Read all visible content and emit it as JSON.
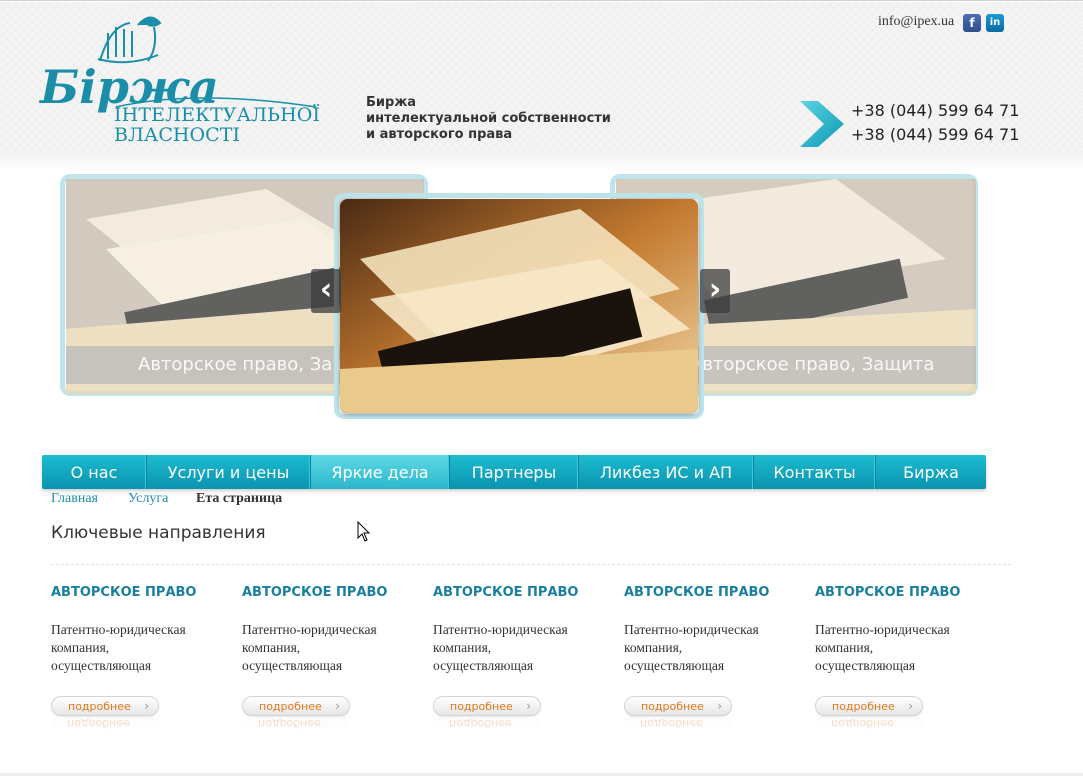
{
  "header": {
    "logo": {
      "script_text": "Біржа",
      "line1": "ІНТЕЛЕКТУАЛЬНОЇ",
      "line2": "ВЛАСНОСТІ"
    },
    "tagline": [
      "Биржа",
      "интелектуальной собственности",
      "и авторского права"
    ],
    "email": "info@ipex.ua",
    "social": {
      "facebook": "f",
      "linkedin": "in"
    },
    "phones": [
      "+38 (044) 599 64 71",
      "+38 (044) 599 64 71"
    ],
    "colors": {
      "brand": "#1a8ea8",
      "accent": "#12b6cc"
    }
  },
  "slider": {
    "left_caption": "Авторское право, Защита",
    "right_caption": "Авторское право, Защита",
    "prev_icon": "chevron-left-icon",
    "next_icon": "chevron-right-icon"
  },
  "menu": {
    "items": [
      {
        "label": "О нас",
        "active": false
      },
      {
        "label": "Услуги и цены",
        "active": false
      },
      {
        "label": "Яркие дела",
        "active": true
      },
      {
        "label": "Партнеры",
        "active": false
      },
      {
        "label": "Ликбез ИС и АП",
        "active": false
      },
      {
        "label": "Контакты",
        "active": false
      },
      {
        "label": "Биржа",
        "active": false
      }
    ]
  },
  "breadcrumb": {
    "home": "Главная",
    "service": "Услуга",
    "current": "Ета страница"
  },
  "main": {
    "section_title": "Ключевые направления",
    "cards": [
      {
        "title": "АВТОРСКОЕ ПРАВО",
        "text": [
          "Патентно-юридическая",
          "компания,",
          "осуществляющая"
        ],
        "button": "подробнее"
      },
      {
        "title": "АВТОРСКОЕ ПРАВО",
        "text": [
          "Патентно-юридическая",
          "компания,",
          "осуществляющая"
        ],
        "button": "подробнее"
      },
      {
        "title": "АВТОРСКОЕ ПРАВО",
        "text": [
          "Патентно-юридическая",
          "компания,",
          "осуществляющая"
        ],
        "button": "подробнее"
      },
      {
        "title": "АВТОРСКОЕ ПРАВО",
        "text": [
          "Патентно-юридическая",
          "компания,",
          "осуществляющая"
        ],
        "button": "подробнее"
      },
      {
        "title": "АВТОРСКОЕ ПРАВО",
        "text": [
          "Патентно-юридическая",
          "компания,",
          "осуществляющая"
        ],
        "button": "подробнее"
      }
    ]
  }
}
